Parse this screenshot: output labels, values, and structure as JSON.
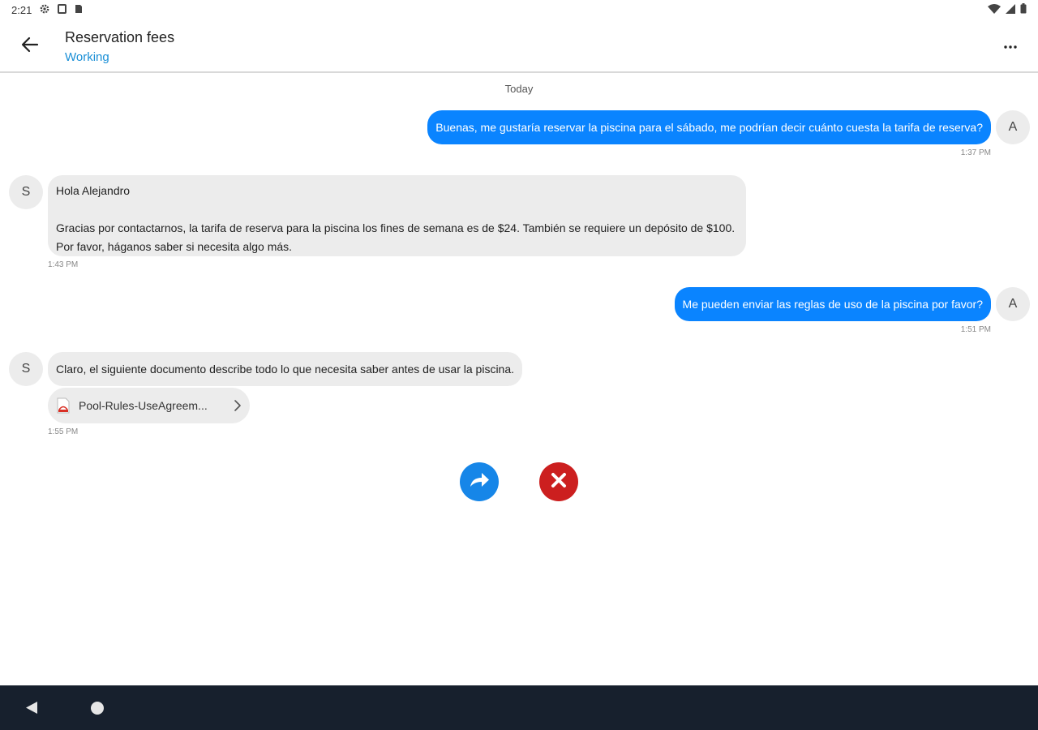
{
  "status_bar": {
    "time": "2:21"
  },
  "header": {
    "title": "Reservation fees",
    "subtitle": "Working"
  },
  "chat": {
    "date_separator": "Today",
    "messages": [
      {
        "direction": "out",
        "avatar": "A",
        "text": "Buenas, me gustaría reservar la piscina para el sábado, me podrían decir cuánto cuesta la tarifa de reserva?",
        "time": "1:37 PM"
      },
      {
        "direction": "in",
        "avatar": "S",
        "greeting": "Hola Alejandro",
        "line1": "Gracias por contactarnos, la tarifa de reserva para la piscina los fines de semana es de $24. También se requiere un depósito de $100.",
        "line2": "Por favor, háganos saber si necesita algo más.",
        "time": "1:43 PM"
      },
      {
        "direction": "out",
        "avatar": "A",
        "text": "Me pueden enviar las reglas de uso de la piscina por favor?",
        "time": "1:51 PM"
      },
      {
        "direction": "in",
        "avatar": "S",
        "text": "Claro, el siguiente documento describe todo lo que necesita saber antes de usar la piscina.",
        "attachment_name": "Pool-Rules-UseAgreem...",
        "time": "1:55 PM"
      }
    ]
  },
  "actions": {
    "forward_icon": "forward-arrow-icon",
    "cancel_icon": "close-icon"
  },
  "colors": {
    "accent": "#0a84ff",
    "subtitle": "#1a8fd6",
    "cancel": "#cc1f1f",
    "nav_bar": "#17202d"
  }
}
